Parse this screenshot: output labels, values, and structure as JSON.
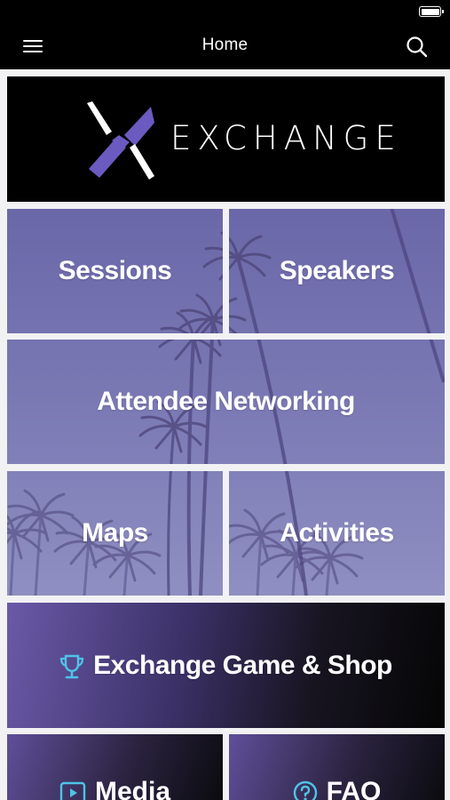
{
  "header": {
    "title": "Home"
  },
  "banner": {
    "brand": "EXCHANGE"
  },
  "tiles": {
    "sessions": "Sessions",
    "speakers": "Speakers",
    "attendee_networking": "Attendee Networking",
    "maps": "Maps",
    "activities": "Activities",
    "game_shop": "Exchange Game & Shop",
    "media": "Media",
    "faq": "FAQ"
  },
  "icons": {
    "menu": "hamburger-menu-icon",
    "search": "search-icon",
    "trophy": "trophy-icon",
    "play": "play-icon",
    "question": "question-icon"
  },
  "colors": {
    "accent_purple": "#6b5bc0",
    "trophy_blue": "#4fc3e8",
    "bar_black": "#000000"
  }
}
